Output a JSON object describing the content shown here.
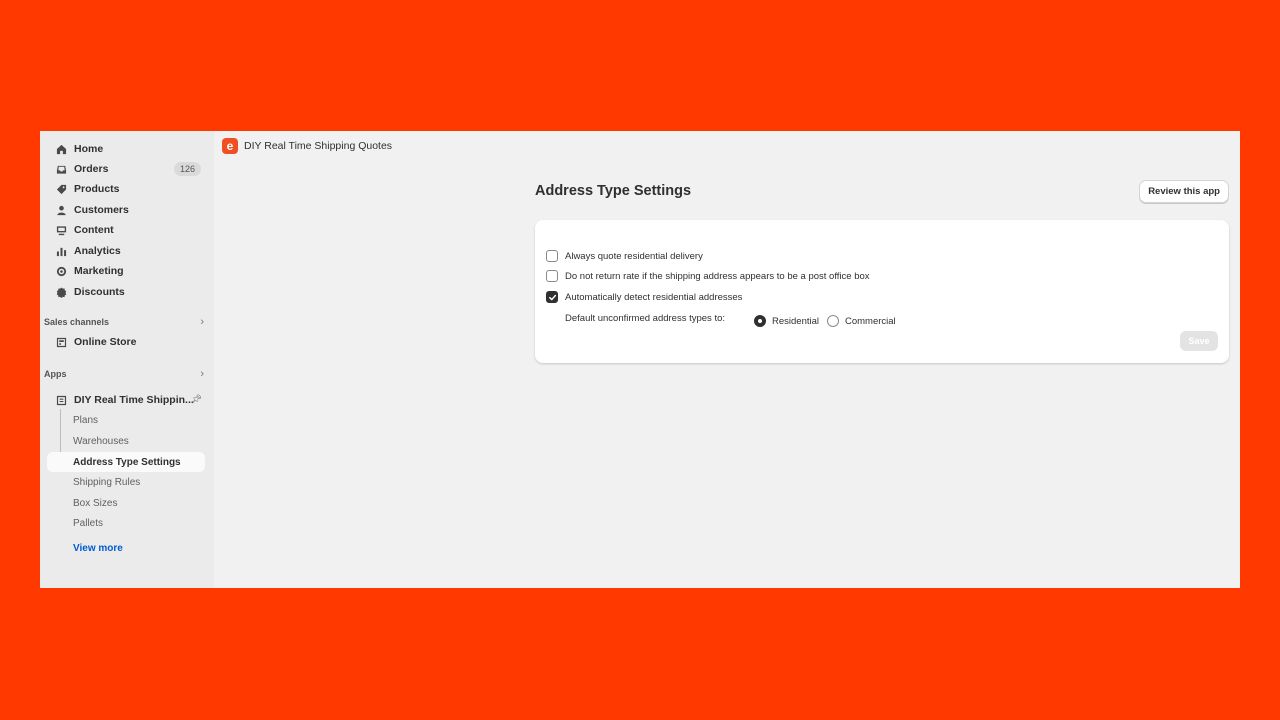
{
  "colors": {
    "backdrop": "#FF3900",
    "accent_logo": "#F04E23",
    "link": "#005BD3"
  },
  "sidebar": {
    "nav": [
      {
        "label": "Home",
        "icon": "home-icon"
      },
      {
        "label": "Orders",
        "icon": "inbox-icon",
        "badge": "126"
      },
      {
        "label": "Products",
        "icon": "tag-icon"
      },
      {
        "label": "Customers",
        "icon": "person-icon"
      },
      {
        "label": "Content",
        "icon": "image-icon"
      },
      {
        "label": "Analytics",
        "icon": "bar-chart-icon"
      },
      {
        "label": "Marketing",
        "icon": "target-icon"
      },
      {
        "label": "Discounts",
        "icon": "discount-icon"
      }
    ],
    "sales_channels": {
      "label": "Sales channels",
      "items": [
        {
          "label": "Online Store",
          "icon": "store-icon"
        }
      ]
    },
    "apps": {
      "label": "Apps",
      "app_name": "DIY Real Time Shippin...",
      "sub_items": [
        {
          "label": "Plans"
        },
        {
          "label": "Warehouses"
        },
        {
          "label": "Address Type Settings"
        },
        {
          "label": "Shipping Rules"
        },
        {
          "label": "Box Sizes"
        },
        {
          "label": "Pallets"
        }
      ],
      "view_more": "View more"
    }
  },
  "header": {
    "logo_letter": "e",
    "app_title": "DIY Real Time Shipping Quotes"
  },
  "main": {
    "page_title": "Address Type Settings",
    "review_button": "Review this app",
    "options": [
      {
        "label": "Always quote residential delivery",
        "checked": false
      },
      {
        "label": "Do not return rate if the shipping address appears to be a post office box",
        "checked": false
      },
      {
        "label": "Automatically detect residential addresses",
        "checked": true
      }
    ],
    "default_label": "Default unconfirmed address types to:",
    "radio_options": [
      {
        "label": "Residential",
        "selected": true
      },
      {
        "label": "Commercial",
        "selected": false
      }
    ],
    "save_button": "Save"
  }
}
